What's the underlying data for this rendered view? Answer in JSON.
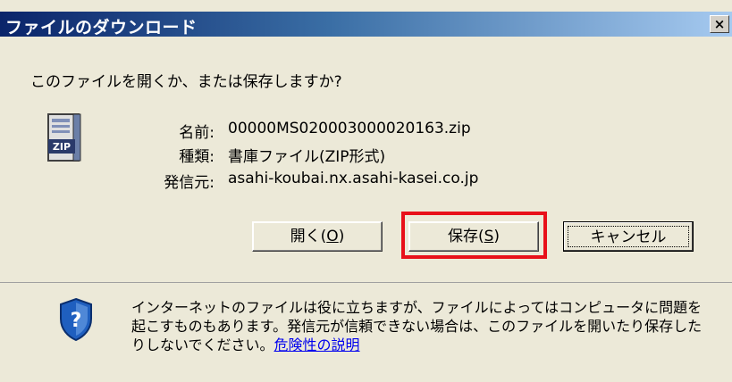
{
  "window": {
    "title": "ファイルのダウンロード",
    "close_glyph": "×"
  },
  "prompt": {
    "question": "このファイルを開くか、または保存しますか?"
  },
  "file": {
    "icon": "zip-file-icon",
    "icon_label": "ZIP",
    "name_label": "名前:",
    "name_value": "00000MS020003000020163.zip",
    "type_label": "種類:",
    "type_value": "書庫ファイル(ZIP形式)",
    "source_label": "発信元:",
    "source_value": "asahi-koubai.nx.asahi-kasei.co.jp"
  },
  "buttons": {
    "open_label": "開く(",
    "open_key": "O",
    "open_suffix": ")",
    "save_label": "保存(",
    "save_key": "S",
    "save_suffix": ")",
    "cancel_label": "キャンセル"
  },
  "warning": {
    "icon": "security-shield-question-icon",
    "text": "インターネットのファイルは役に立ちますが、ファイルによってはコンピュータに問題を起こすものもあります。発信元が信頼できない場合は、このファイルを開いたり保存したりしないでください。",
    "link": "危険性の説明"
  },
  "colors": {
    "highlight": "#e8101a",
    "title_bar": "#0a246a",
    "link": "#0000ee"
  }
}
